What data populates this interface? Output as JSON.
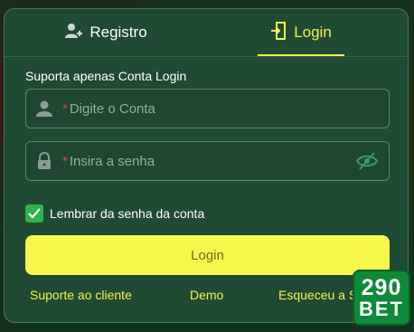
{
  "tabs": {
    "register_label": "Registro",
    "login_label": "Login"
  },
  "form": {
    "subtitle": "Suporta apenas Conta Login",
    "account_placeholder": "Digite o Conta",
    "password_placeholder": "Insira a senha",
    "required_mark": "*",
    "remember_label": "Lembrar da senha da conta",
    "remember_checked": true,
    "login_button": "Login"
  },
  "footer": {
    "support": "Suporte ao cliente",
    "demo": "Demo",
    "forgot": "Esqueceu a S"
  },
  "logo": {
    "line1": "290",
    "line2": "BET"
  },
  "colors": {
    "accent": "#f6f54a",
    "panel": "#1f4a33",
    "checkbox": "#2fb24c",
    "required": "#e0413b"
  },
  "icons": [
    "add-user-icon",
    "login-door-icon",
    "user-icon",
    "lock-icon",
    "eye-hidden-icon",
    "checkmark-icon"
  ]
}
